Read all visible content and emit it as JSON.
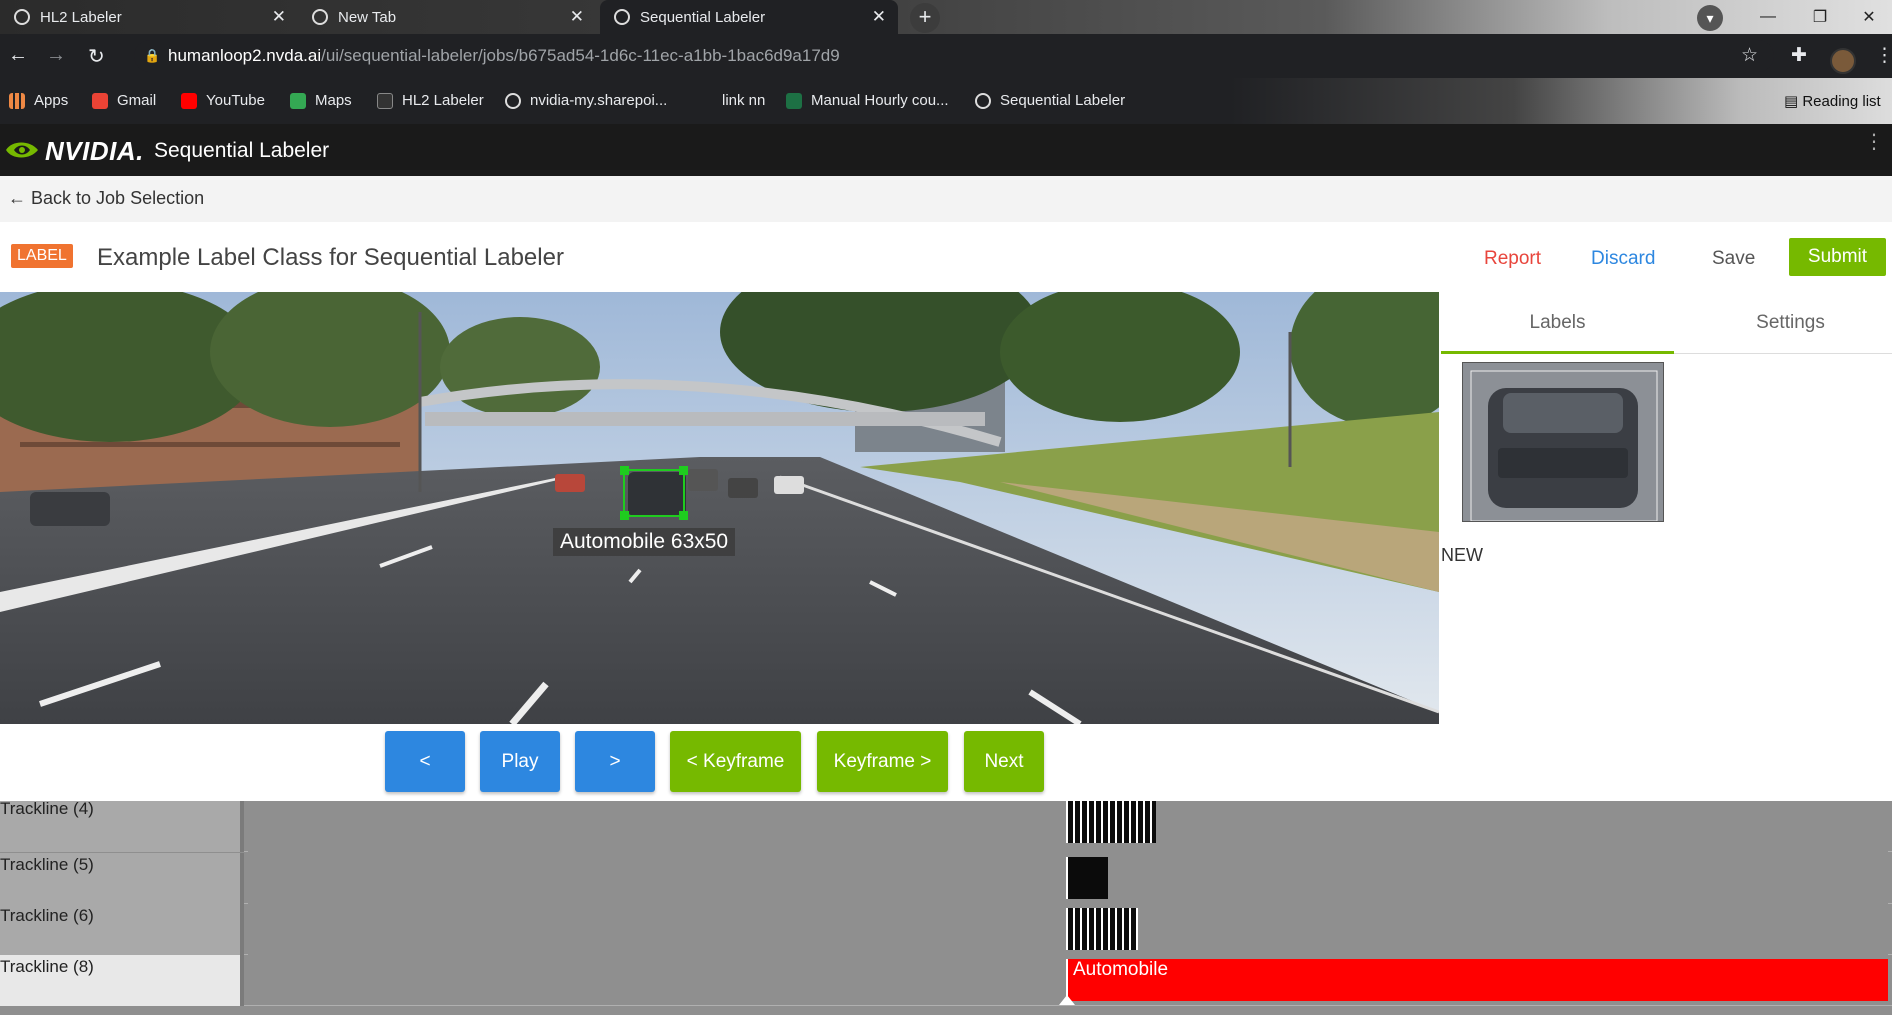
{
  "browser": {
    "tabs": [
      {
        "title": "HL2 Labeler",
        "active": false
      },
      {
        "title": "New Tab",
        "active": false
      },
      {
        "title": "Sequential Labeler",
        "active": true
      }
    ],
    "url_host": "humanloop2.nvda.ai",
    "url_path": "/ui/sequential-labeler/jobs/b675ad54-1d6c-11ec-a1bb-1bac6d9a17d9",
    "bookmarks": [
      {
        "label": "Apps",
        "icon": "apps-grid-icon"
      },
      {
        "label": "Gmail",
        "icon": "gmail-icon"
      },
      {
        "label": "YouTube",
        "icon": "youtube-icon"
      },
      {
        "label": "Maps",
        "icon": "maps-icon"
      },
      {
        "label": "HL2 Labeler",
        "icon": "nvidia-icon"
      },
      {
        "label": "nvidia-my.sharepoi...",
        "icon": "globe-icon"
      },
      {
        "label": "link nn",
        "icon": "blank-icon"
      },
      {
        "label": "Manual Hourly cou...",
        "icon": "excel-icon"
      },
      {
        "label": "Sequential Labeler",
        "icon": "globe-icon"
      }
    ],
    "reading_list": "Reading list"
  },
  "app": {
    "brand": "NVIDIA.",
    "title": "Sequential Labeler",
    "back_link": "Back to Job Selection",
    "badge": "LABEL",
    "task_title": "Example Label Class for Sequential Labeler",
    "actions": {
      "report": "Report",
      "discard": "Discard",
      "save": "Save",
      "submit": "Submit"
    },
    "colors": {
      "accent": "#76b900",
      "report": "#e8453c",
      "discard": "#2d87e0",
      "badge": "#f07330",
      "bbox": "#1fcc1f",
      "track_fill": "#ff0000"
    }
  },
  "viewer": {
    "annotation_label": "Automobile  63x50"
  },
  "side_panel": {
    "tabs": [
      "Labels",
      "Settings"
    ],
    "active_tab": "Labels",
    "item_status": "NEW"
  },
  "controls": {
    "prev": "<",
    "play": "Play",
    "next_frame": ">",
    "prev_keyframe": "< Keyframe",
    "next_keyframe": "Keyframe >",
    "next": "Next"
  },
  "timeline": {
    "tracks": [
      {
        "name": "Trackline (4)",
        "selected": false
      },
      {
        "name": "Trackline (5)",
        "selected": false
      },
      {
        "name": "Trackline (6)",
        "selected": false
      },
      {
        "name": "Trackline (8)",
        "selected": true,
        "bar_label": "Automobile"
      }
    ]
  }
}
